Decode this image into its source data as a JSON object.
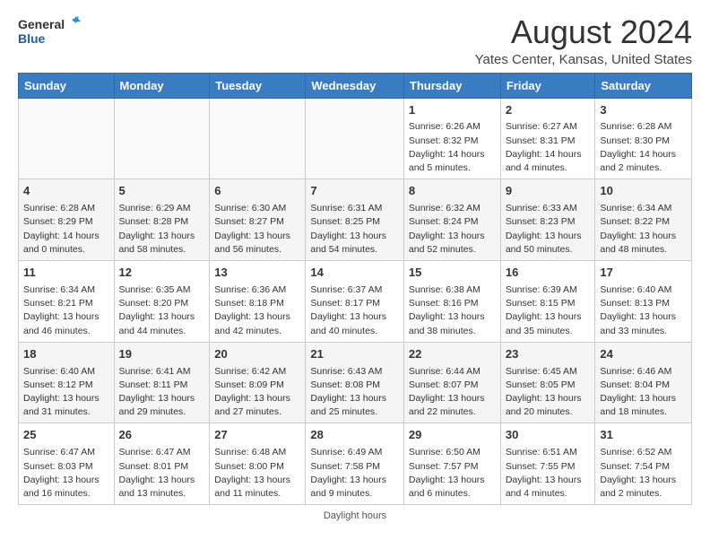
{
  "logo": {
    "line1": "General",
    "line2": "Blue"
  },
  "title": "August 2024",
  "subtitle": "Yates Center, Kansas, United States",
  "days_of_week": [
    "Sunday",
    "Monday",
    "Tuesday",
    "Wednesday",
    "Thursday",
    "Friday",
    "Saturday"
  ],
  "weeks": [
    [
      {
        "day": "",
        "detail": ""
      },
      {
        "day": "",
        "detail": ""
      },
      {
        "day": "",
        "detail": ""
      },
      {
        "day": "",
        "detail": ""
      },
      {
        "day": "1",
        "detail": "Sunrise: 6:26 AM\nSunset: 8:32 PM\nDaylight: 14 hours\nand 5 minutes."
      },
      {
        "day": "2",
        "detail": "Sunrise: 6:27 AM\nSunset: 8:31 PM\nDaylight: 14 hours\nand 4 minutes."
      },
      {
        "day": "3",
        "detail": "Sunrise: 6:28 AM\nSunset: 8:30 PM\nDaylight: 14 hours\nand 2 minutes."
      }
    ],
    [
      {
        "day": "4",
        "detail": "Sunrise: 6:28 AM\nSunset: 8:29 PM\nDaylight: 14 hours\nand 0 minutes."
      },
      {
        "day": "5",
        "detail": "Sunrise: 6:29 AM\nSunset: 8:28 PM\nDaylight: 13 hours\nand 58 minutes."
      },
      {
        "day": "6",
        "detail": "Sunrise: 6:30 AM\nSunset: 8:27 PM\nDaylight: 13 hours\nand 56 minutes."
      },
      {
        "day": "7",
        "detail": "Sunrise: 6:31 AM\nSunset: 8:25 PM\nDaylight: 13 hours\nand 54 minutes."
      },
      {
        "day": "8",
        "detail": "Sunrise: 6:32 AM\nSunset: 8:24 PM\nDaylight: 13 hours\nand 52 minutes."
      },
      {
        "day": "9",
        "detail": "Sunrise: 6:33 AM\nSunset: 8:23 PM\nDaylight: 13 hours\nand 50 minutes."
      },
      {
        "day": "10",
        "detail": "Sunrise: 6:34 AM\nSunset: 8:22 PM\nDaylight: 13 hours\nand 48 minutes."
      }
    ],
    [
      {
        "day": "11",
        "detail": "Sunrise: 6:34 AM\nSunset: 8:21 PM\nDaylight: 13 hours\nand 46 minutes."
      },
      {
        "day": "12",
        "detail": "Sunrise: 6:35 AM\nSunset: 8:20 PM\nDaylight: 13 hours\nand 44 minutes."
      },
      {
        "day": "13",
        "detail": "Sunrise: 6:36 AM\nSunset: 8:18 PM\nDaylight: 13 hours\nand 42 minutes."
      },
      {
        "day": "14",
        "detail": "Sunrise: 6:37 AM\nSunset: 8:17 PM\nDaylight: 13 hours\nand 40 minutes."
      },
      {
        "day": "15",
        "detail": "Sunrise: 6:38 AM\nSunset: 8:16 PM\nDaylight: 13 hours\nand 38 minutes."
      },
      {
        "day": "16",
        "detail": "Sunrise: 6:39 AM\nSunset: 8:15 PM\nDaylight: 13 hours\nand 35 minutes."
      },
      {
        "day": "17",
        "detail": "Sunrise: 6:40 AM\nSunset: 8:13 PM\nDaylight: 13 hours\nand 33 minutes."
      }
    ],
    [
      {
        "day": "18",
        "detail": "Sunrise: 6:40 AM\nSunset: 8:12 PM\nDaylight: 13 hours\nand 31 minutes."
      },
      {
        "day": "19",
        "detail": "Sunrise: 6:41 AM\nSunset: 8:11 PM\nDaylight: 13 hours\nand 29 minutes."
      },
      {
        "day": "20",
        "detail": "Sunrise: 6:42 AM\nSunset: 8:09 PM\nDaylight: 13 hours\nand 27 minutes."
      },
      {
        "day": "21",
        "detail": "Sunrise: 6:43 AM\nSunset: 8:08 PM\nDaylight: 13 hours\nand 25 minutes."
      },
      {
        "day": "22",
        "detail": "Sunrise: 6:44 AM\nSunset: 8:07 PM\nDaylight: 13 hours\nand 22 minutes."
      },
      {
        "day": "23",
        "detail": "Sunrise: 6:45 AM\nSunset: 8:05 PM\nDaylight: 13 hours\nand 20 minutes."
      },
      {
        "day": "24",
        "detail": "Sunrise: 6:46 AM\nSunset: 8:04 PM\nDaylight: 13 hours\nand 18 minutes."
      }
    ],
    [
      {
        "day": "25",
        "detail": "Sunrise: 6:47 AM\nSunset: 8:03 PM\nDaylight: 13 hours\nand 16 minutes."
      },
      {
        "day": "26",
        "detail": "Sunrise: 6:47 AM\nSunset: 8:01 PM\nDaylight: 13 hours\nand 13 minutes."
      },
      {
        "day": "27",
        "detail": "Sunrise: 6:48 AM\nSunset: 8:00 PM\nDaylight: 13 hours\nand 11 minutes."
      },
      {
        "day": "28",
        "detail": "Sunrise: 6:49 AM\nSunset: 7:58 PM\nDaylight: 13 hours\nand 9 minutes."
      },
      {
        "day": "29",
        "detail": "Sunrise: 6:50 AM\nSunset: 7:57 PM\nDaylight: 13 hours\nand 6 minutes."
      },
      {
        "day": "30",
        "detail": "Sunrise: 6:51 AM\nSunset: 7:55 PM\nDaylight: 13 hours\nand 4 minutes."
      },
      {
        "day": "31",
        "detail": "Sunrise: 6:52 AM\nSunset: 7:54 PM\nDaylight: 13 hours\nand 2 minutes."
      }
    ]
  ],
  "footer": "Daylight hours"
}
